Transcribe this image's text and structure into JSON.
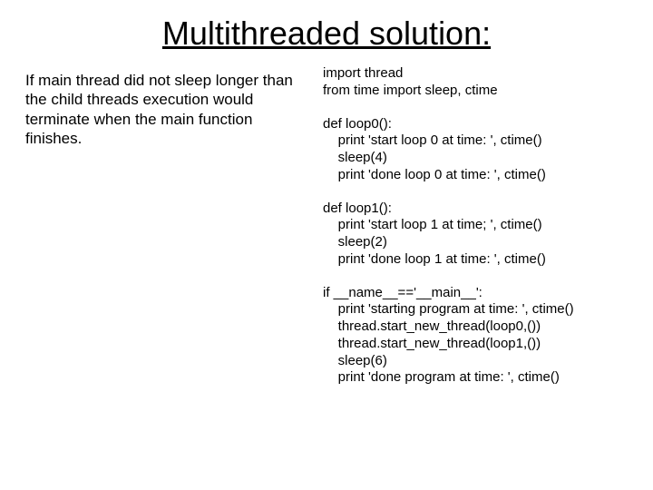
{
  "title": "Multithreaded solution:",
  "left": {
    "text": "If main thread did not sleep longer than the child threads execution would terminate when the main function finishes."
  },
  "code": {
    "imports": "import thread\nfrom time import sleep, ctime",
    "loop0": "def loop0():\n    print 'start loop 0 at time: ', ctime()\n    sleep(4)\n    print 'done loop 0 at time: ', ctime()",
    "loop1": "def loop1():\n    print 'start loop 1 at time; ', ctime()\n    sleep(2)\n    print 'done loop 1 at time: ', ctime()",
    "main": "if __name__=='__main__':\n    print 'starting program at time: ', ctime()\n    thread.start_new_thread(loop0,())\n    thread.start_new_thread(loop1,())\n    sleep(6)\n    print 'done program at time: ', ctime()"
  }
}
